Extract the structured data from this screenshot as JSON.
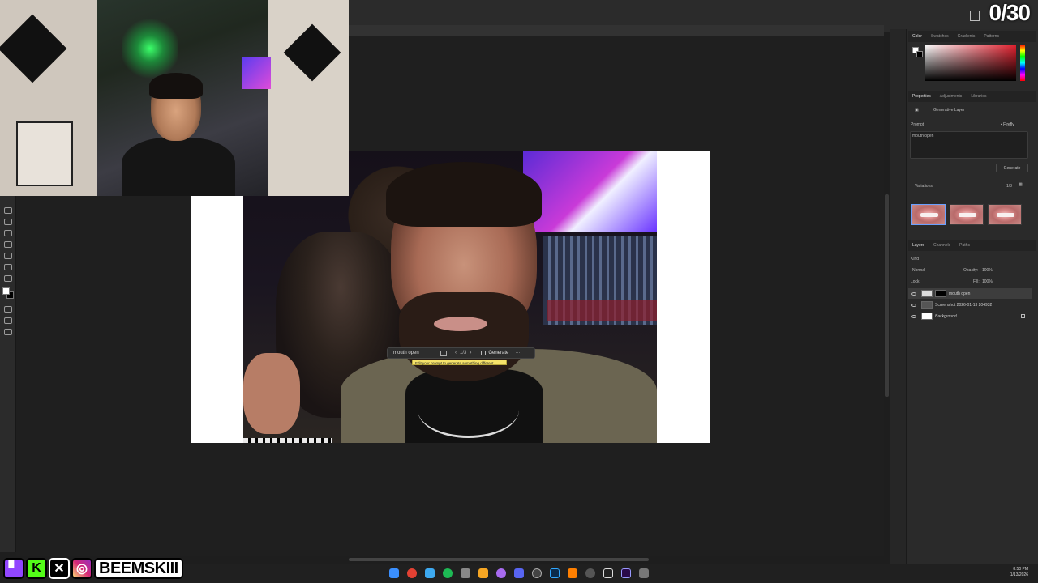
{
  "overlay": {
    "counter": "0/30",
    "handle": "BEEMSKIII"
  },
  "color_panel": {
    "tabs": [
      "Color",
      "Swatches",
      "Gradients",
      "Patterns"
    ]
  },
  "properties_panel": {
    "tabs": [
      "Properties",
      "Adjustments",
      "Libraries"
    ],
    "layer_type": "Generative Layer",
    "prompt_label": "Prompt",
    "model": "Firefly",
    "prompt_value": "mouth open",
    "generate_label": "Generate",
    "variations_label": "Variations",
    "variations_count": "1/3"
  },
  "layers_panel": {
    "tabs": [
      "Layers",
      "Channels",
      "Paths"
    ],
    "filter_label": "Kind",
    "blend_mode": "Normal",
    "opacity_label": "Opacity:",
    "opacity_value": "100%",
    "lock_label": "Lock:",
    "fill_label": "Fill:",
    "fill_value": "100%",
    "layers": [
      "mouth open",
      "Screenshot 2026-01-13 204932",
      "Background"
    ]
  },
  "contextual_bar": {
    "prompt": "mouth open",
    "count": "1/3",
    "generate": "Generate",
    "more": "···",
    "tooltip": "Edit your prompt to generate something different"
  },
  "taskbar": {
    "time": "8:50 PM",
    "date": "1/13/2026"
  },
  "colors": {
    "accent_selection": "#6aa0ff",
    "tooltip_bg": "#f6e36a"
  }
}
